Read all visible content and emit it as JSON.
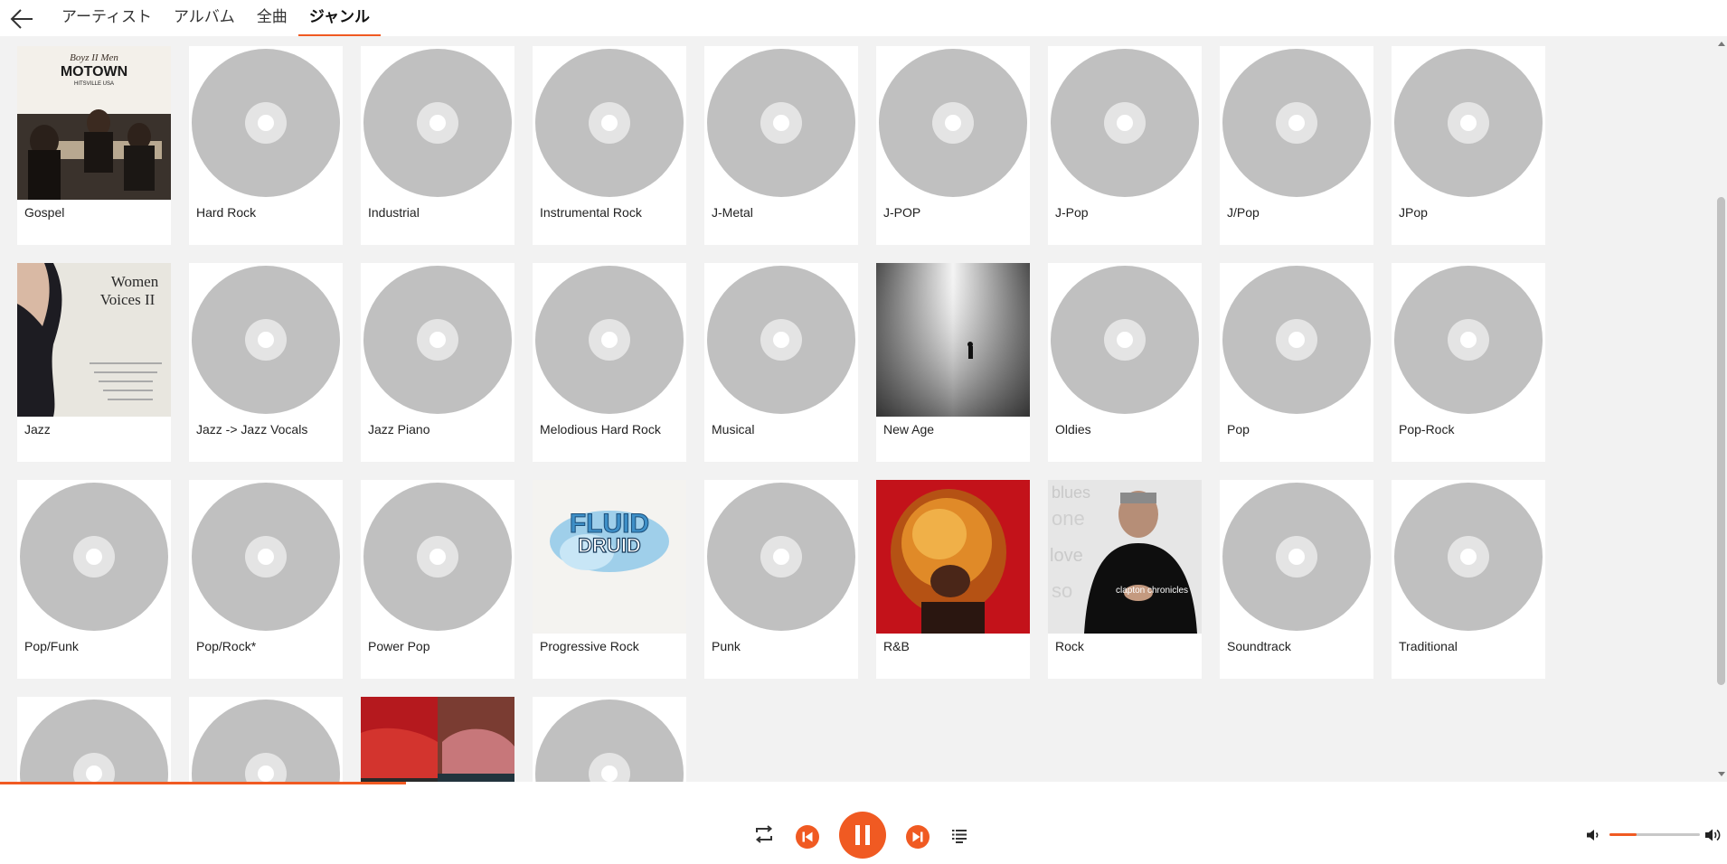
{
  "nav": {
    "tabs": [
      {
        "label": "アーティスト",
        "active": false
      },
      {
        "label": "アルバム",
        "active": false
      },
      {
        "label": "全曲",
        "active": false
      },
      {
        "label": "ジャンル",
        "active": true
      }
    ]
  },
  "genres": [
    {
      "label": "Gospel",
      "art": "cover-gospel"
    },
    {
      "label": "Hard Rock",
      "art": "disc"
    },
    {
      "label": "Industrial",
      "art": "disc"
    },
    {
      "label": "Instrumental Rock",
      "art": "disc"
    },
    {
      "label": "J-Metal",
      "art": "disc"
    },
    {
      "label": "J-POP",
      "art": "disc"
    },
    {
      "label": "J-Pop",
      "art": "disc"
    },
    {
      "label": "J/Pop",
      "art": "disc"
    },
    {
      "label": "JPop",
      "art": "disc"
    },
    {
      "label": "Jazz",
      "art": "cover-jazz"
    },
    {
      "label": "Jazz -> Jazz Vocals",
      "art": "disc"
    },
    {
      "label": "Jazz Piano",
      "art": "disc"
    },
    {
      "label": "Melodious Hard Rock",
      "art": "disc"
    },
    {
      "label": "Musical",
      "art": "disc"
    },
    {
      "label": "New Age",
      "art": "cover-newage"
    },
    {
      "label": "Oldies",
      "art": "disc"
    },
    {
      "label": "Pop",
      "art": "disc"
    },
    {
      "label": "Pop-Rock",
      "art": "disc"
    },
    {
      "label": "Pop/Funk",
      "art": "disc"
    },
    {
      "label": "Pop/Rock*",
      "art": "disc"
    },
    {
      "label": "Power Pop",
      "art": "disc"
    },
    {
      "label": "Progressive Rock",
      "art": "cover-progressive"
    },
    {
      "label": "Punk",
      "art": "disc"
    },
    {
      "label": "R&B",
      "art": "cover-rnb"
    },
    {
      "label": "Rock",
      "art": "cover-rock"
    },
    {
      "label": "Soundtrack",
      "art": "disc"
    },
    {
      "label": "Traditional",
      "art": "disc"
    },
    {
      "label": "",
      "art": "disc"
    },
    {
      "label": "",
      "art": "disc"
    },
    {
      "label": "",
      "art": "cover-collage"
    },
    {
      "label": "",
      "art": "disc"
    }
  ],
  "covers": {
    "gospel": {
      "line1": "Boyz II Men",
      "line2": "MOTOWN",
      "line3": "HITSVILLE USA"
    },
    "jazz": {
      "line1": "Women",
      "line2": "Voices II"
    },
    "progressive": {
      "line1": "FLUID",
      "line2": "DRUID"
    },
    "rock": {
      "line1": "clapton chronicles"
    }
  },
  "player": {
    "seek_progress": 0.235,
    "volume": 0.3,
    "state": "playing"
  },
  "colors": {
    "accent": "#f05a22",
    "disc": "#c0c0c0",
    "background": "#f2f2f2"
  },
  "icons": {
    "back": "arrow-left-icon",
    "repeat": "repeat-icon",
    "prev": "skip-previous-icon",
    "pause": "pause-icon",
    "next": "skip-next-icon",
    "queue": "queue-list-icon",
    "volume_low": "volume-low-icon",
    "volume_high": "volume-high-icon"
  }
}
